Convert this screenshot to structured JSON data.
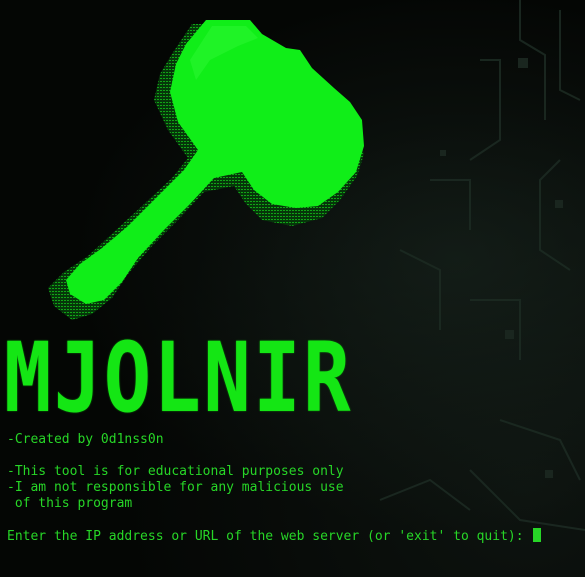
{
  "title": "MJOLNIR",
  "icons": {
    "logo": "hammer-icon"
  },
  "colors": {
    "accent": "#14e614",
    "text": "#27d627",
    "background": "#040604"
  },
  "lines": {
    "created_by": "-Created by 0d1nss0n",
    "disclaimer_1": "-This tool is for educational purposes only",
    "disclaimer_2": "-I am not responsible for any malicious use",
    "disclaimer_3": " of this program",
    "prompt": "Enter the IP address or URL of the web server (or 'exit' to quit): "
  }
}
